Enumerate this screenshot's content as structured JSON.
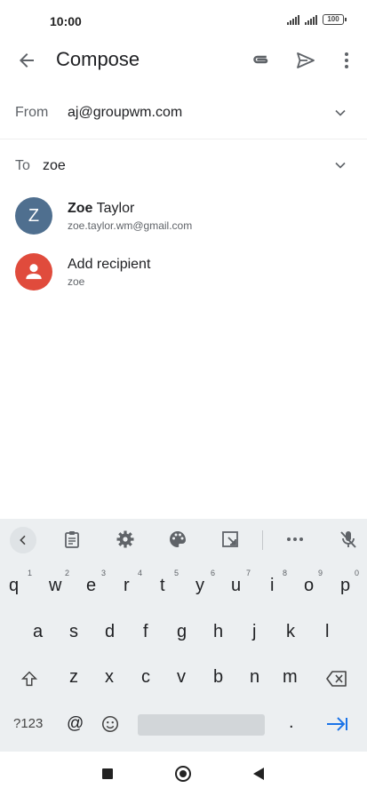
{
  "status_bar": {
    "time": "10:00",
    "battery": "100"
  },
  "app_bar": {
    "title": "Compose"
  },
  "from": {
    "label": "From",
    "value": "aj@groupwm.com"
  },
  "to": {
    "label": "To",
    "value": "zoe"
  },
  "suggestions": [
    {
      "initial": "Z",
      "name_bold": "Zoe",
      "name_rest": " Taylor",
      "sub": "zoe.taylor.wm@gmail.com",
      "color": "#4f6f8f"
    },
    {
      "name": "Add recipient",
      "sub": "zoe",
      "color": "#e04b3c"
    }
  ],
  "keyboard": {
    "row1": [
      "q",
      "w",
      "e",
      "r",
      "t",
      "y",
      "u",
      "i",
      "o",
      "p"
    ],
    "row1_hints": [
      "1",
      "2",
      "3",
      "4",
      "5",
      "6",
      "7",
      "8",
      "9",
      "0"
    ],
    "row2": [
      "a",
      "s",
      "d",
      "f",
      "g",
      "h",
      "j",
      "k",
      "l"
    ],
    "row3": [
      "z",
      "x",
      "c",
      "v",
      "b",
      "n",
      "m"
    ],
    "symbols_key": "?123",
    "at_key": "@",
    "period_key": "."
  },
  "icons": [
    "back-arrow-icon",
    "attach-icon",
    "send-icon",
    "more-vert-icon",
    "chevron-down-icon",
    "person-icon",
    "clipboard-icon",
    "settings-icon",
    "palette-icon",
    "resize-icon",
    "ellipsis-icon",
    "mic-off-icon",
    "shift-icon",
    "backspace-icon",
    "emoji-icon",
    "tab-enter-icon",
    "nav-square-icon",
    "nav-home-icon",
    "nav-back-icon"
  ],
  "colors": {
    "accent": "#1a73e8",
    "keyboard_bg": "#eceff1"
  }
}
